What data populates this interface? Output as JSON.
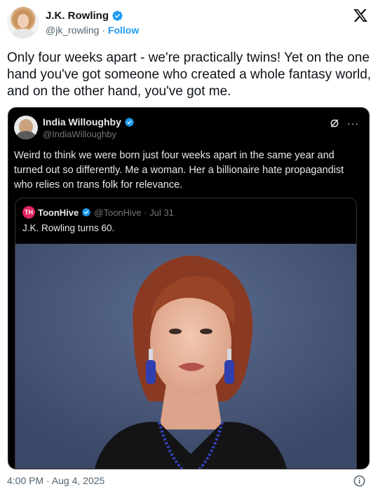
{
  "author": {
    "display_name": "J.K. Rowling",
    "handle": "@jk_rowling",
    "separator": "·",
    "follow_label": "Follow"
  },
  "tweet": {
    "text": "Only four weeks apart - we're practically twins! Yet on the one hand you've got someone who created a whole fantasy world, and on the other hand, you've got me.",
    "timestamp": "4:00 PM · Aug 4, 2025"
  },
  "quoted_tweet": {
    "display_name": "India Willoughby",
    "handle": "@IndiaWilloughby",
    "text": "Weird to think we were born just four weeks apart in the same year and turned out so differently. Me a woman. Her a billionaire hate propagandist who relies on trans folk for relevance.",
    "more_label": "···"
  },
  "nested_quote": {
    "logo_text": "TH",
    "display_name": "ToonHive",
    "meta": "@ToonHive · Jul 31",
    "text": "J.K. Rowling turns 60."
  },
  "colors": {
    "verified_blue": "#1d9bf0",
    "link_blue": "#1d9bf0",
    "dark_bg": "#000000",
    "muted_gray": "#536471"
  },
  "icons": {
    "brand": "x-logo-icon",
    "verified": "verified-badge-icon",
    "info": "info-icon",
    "grok": "grok-icon"
  }
}
